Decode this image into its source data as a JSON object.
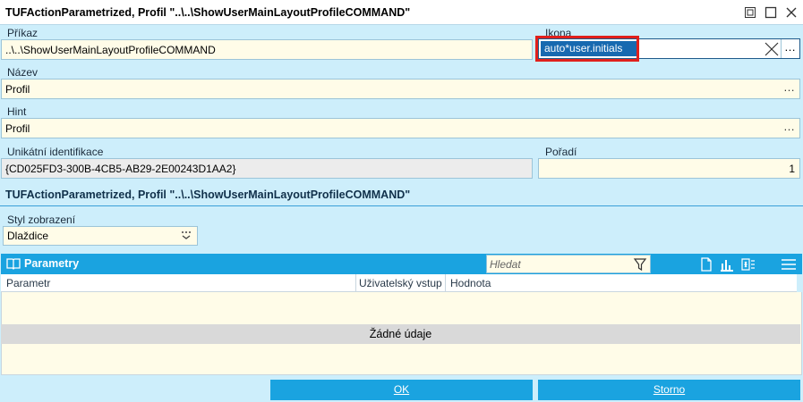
{
  "window": {
    "title": "TUFActionParametrized, Profil \"..\\..\\ShowUserMainLayoutProfileCOMMAND\""
  },
  "fields": {
    "prikaz": {
      "label": "Příkaz",
      "value": "..\\..\\ShowUserMainLayoutProfileCOMMAND"
    },
    "ikona": {
      "label": "Ikona",
      "value": "auto*user.initials"
    },
    "nazev": {
      "label": "Název",
      "value": "Profil"
    },
    "hint": {
      "label": "Hint",
      "value": "Profil"
    },
    "unikatni": {
      "label": "Unikátní identifikace",
      "value": "{CD025FD3-300B-4CB5-AB29-2E00243D1AA2}"
    },
    "poradi": {
      "label": "Pořadí",
      "value": "1"
    }
  },
  "section": {
    "title": "TUFActionParametrized, Profil \"..\\..\\ShowUserMainLayoutProfileCOMMAND\""
  },
  "styl": {
    "label": "Styl zobrazení",
    "value": "Dlaždice"
  },
  "grid": {
    "title": "Parametry",
    "search_placeholder": "Hledat",
    "columns": [
      "Parametr",
      "Uživatelský vstup",
      "Hodnota"
    ],
    "empty_text": "Žádné údaje"
  },
  "buttons": {
    "ok": "OK",
    "cancel": "Storno"
  },
  "icons": {
    "ellipsis": "…",
    "highlight_color": "#e0201c",
    "accent": "#1aa3e0"
  }
}
